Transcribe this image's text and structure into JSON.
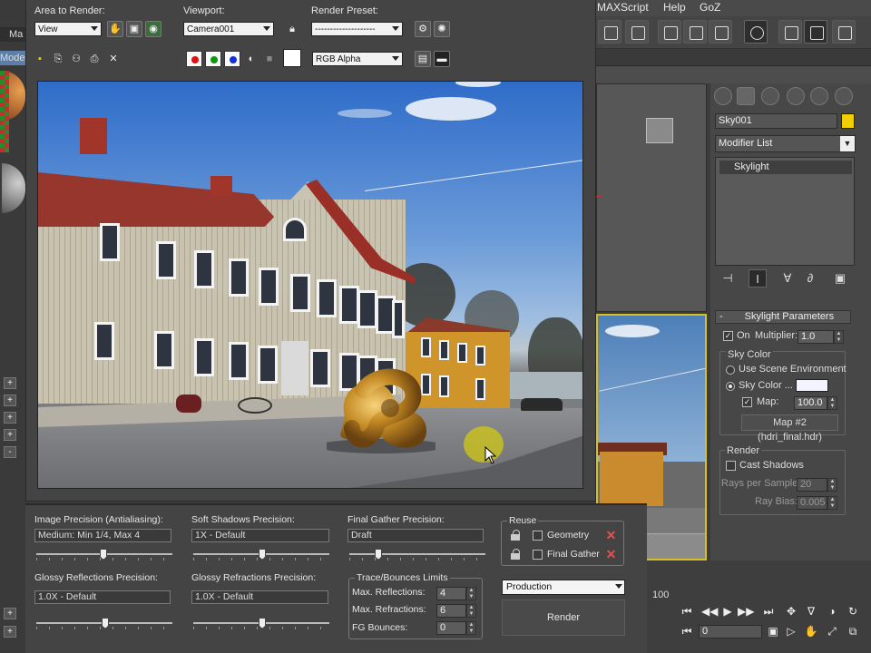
{
  "menu": {
    "maxscript": "MAXScript",
    "help": "Help",
    "goz": "GoZ"
  },
  "left_strip": {
    "tab1": "Ma",
    "tab2": "Mode"
  },
  "render_frame": {
    "area_label": "Area to Render:",
    "area_value": "View",
    "viewport_label": "Viewport:",
    "viewport_value": "Camera001",
    "preset_label": "Render Preset:",
    "preset_value": "--------------------",
    "channel_value": "RGB Alpha",
    "colors": {
      "red": "#e01010",
      "green": "#0a9a0a",
      "blue": "#1030e0"
    }
  },
  "render_setup": {
    "image_precision_label": "Image Precision (Antialiasing):",
    "image_precision_value": "Medium: Min 1/4, Max 4",
    "soft_shadows_label": "Soft Shadows Precision:",
    "soft_shadows_value": "1X - Default",
    "final_gather_label": "Final Gather Precision:",
    "final_gather_value": "Draft",
    "glossy_refl_label": "Glossy Reflections Precision:",
    "glossy_refl_value": "1.0X - Default",
    "glossy_refr_label": "Glossy Refractions Precision:",
    "glossy_refr_value": "1.0X - Default",
    "reuse_title": "Reuse",
    "reuse_geometry": "Geometry",
    "reuse_final_gather": "Final Gather",
    "trace_title": "Trace/Bounces Limits",
    "max_reflections_label": "Max. Reflections:",
    "max_reflections_value": "4",
    "max_refractions_label": "Max. Refractions:",
    "max_refractions_value": "6",
    "fg_bounces_label": "FG Bounces:",
    "fg_bounces_value": "0",
    "mode_value": "Production",
    "render_button": "Render"
  },
  "command_panel": {
    "object_name": "Sky001",
    "object_color": "#f0d000",
    "modifier_list": "Modifier List",
    "stack_item": "Skylight",
    "rollout_title": "Skylight Parameters",
    "on_label": "On",
    "multiplier_label": "Multiplier:",
    "multiplier_value": "1.0",
    "sky_color_title": "Sky Color",
    "use_scene_env": "Use Scene Environment",
    "sky_color_label": "Sky Color ...",
    "map_label": "Map:",
    "map_value": "100.0",
    "map_button": "Map #2 (hdri_final.hdr)",
    "render_title": "Render",
    "cast_shadows": "Cast Shadows",
    "rays_label": "Rays per Sample:",
    "rays_value": "20",
    "ray_bias_label": "Ray Bias:",
    "ray_bias_value": "0.005"
  },
  "timeline": {
    "frame_label": "100",
    "current_frame": "0"
  }
}
